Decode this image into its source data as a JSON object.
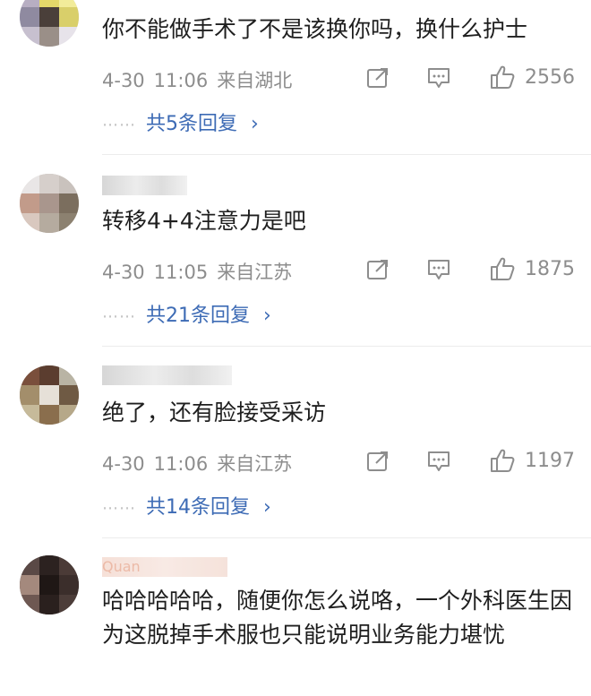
{
  "comments": [
    {
      "username": "",
      "text": "你不能做手术了不是该换你吗，换什么护士",
      "date": "4-30",
      "time": "11:06",
      "location": "来自湖北",
      "likes": "2556",
      "replies": "共5条回复",
      "reply_arrow": "›"
    },
    {
      "username": "",
      "text": "转移4+4注意力是吧",
      "date": "4-30",
      "time": "11:05",
      "location": "来自江苏",
      "likes": "1875",
      "replies": "共21条回复",
      "reply_arrow": "›"
    },
    {
      "username": "",
      "text": "绝了，还有脸接受采访",
      "date": "4-30",
      "time": "11:06",
      "location": "来自江苏",
      "likes": "1197",
      "replies": "共14条回复",
      "reply_arrow": "›"
    },
    {
      "username": "Quan",
      "text": "哈哈哈哈哈，随便你怎么说咯，一个外科医生因为这脱掉手术服也只能说明业务能力堪忧"
    }
  ],
  "dots": "⋯⋯",
  "icons": {
    "share": "share-icon",
    "comment": "comment-icon",
    "like": "thumbs-up-icon"
  },
  "colors": {
    "reply_link": "#3d6bb5",
    "meta_gray": "#8d8d8d"
  }
}
